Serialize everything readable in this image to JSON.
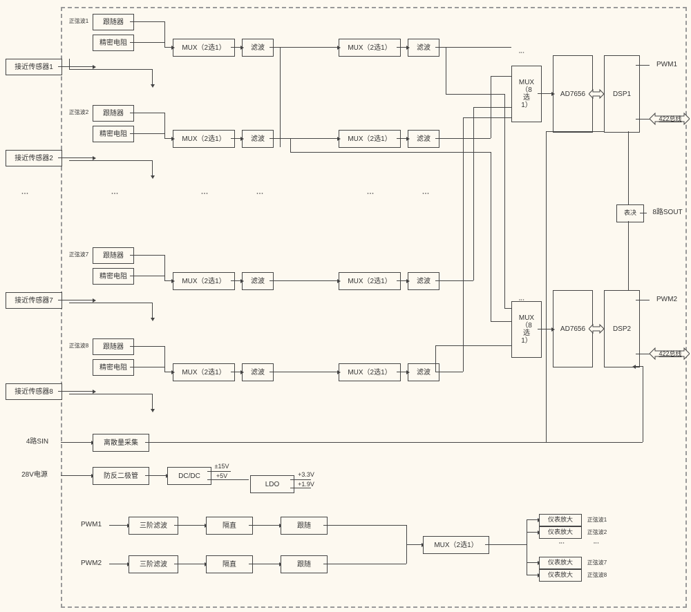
{
  "external_inputs": {
    "sensor1": "接近传感器1",
    "sensor2": "接近传感器2",
    "sensor7": "接近传感器7",
    "sensor8": "接近传感器8",
    "sin4": "4路SIN",
    "pwr28": "28V电源",
    "pwm1": "PWM1",
    "pwm2": "PWM2"
  },
  "channel_labels": {
    "sine1": "正弦波1",
    "sine2": "正弦波2",
    "sine7": "正弦波7",
    "sine8": "正弦波8",
    "follower": "跟随器",
    "precise_res": "精密电阻",
    "mux2_1": "MUX（2选1）",
    "filter": "滤波"
  },
  "right_blocks": {
    "mux8_1": "MUX\n（8\n选\n1）",
    "adc": "AD7656",
    "dsp1": "DSP1",
    "dsp2": "DSP2",
    "voter": "表决"
  },
  "right_outputs": {
    "pwm1": "PWM1",
    "bus422": "422总线",
    "sout8": "8路SOUT",
    "pwm2": "PWM2"
  },
  "discrete": {
    "block": "离散量采集"
  },
  "power": {
    "diode": "防反二极管",
    "dcdc": "DC/DC",
    "v15": "±15V",
    "v5": "+5V",
    "ldo": "LDO",
    "v33": "+3.3V",
    "v19": "+1.9V"
  },
  "pwm_gen": {
    "three_order": "三阶滤波",
    "dc_block": "隔直",
    "follow": "跟随",
    "mux2_1": "MUX（2选1）",
    "inst_amp": "仪表放大",
    "sine_out1": "正弦波1",
    "sine_out2": "正弦波2",
    "sine_out7": "正弦波7",
    "sine_out8": "正弦波8"
  },
  "diagram_desc": "Block diagram of an 8-channel proximity-sensor acquisition and processing board with dual redundant signal chains (MUX→filter→8:1 MUX→AD7656→DSP1/DSP2), PWM-based sine excitation, discrete input acquisition, and a 28V power-conditioning stage."
}
